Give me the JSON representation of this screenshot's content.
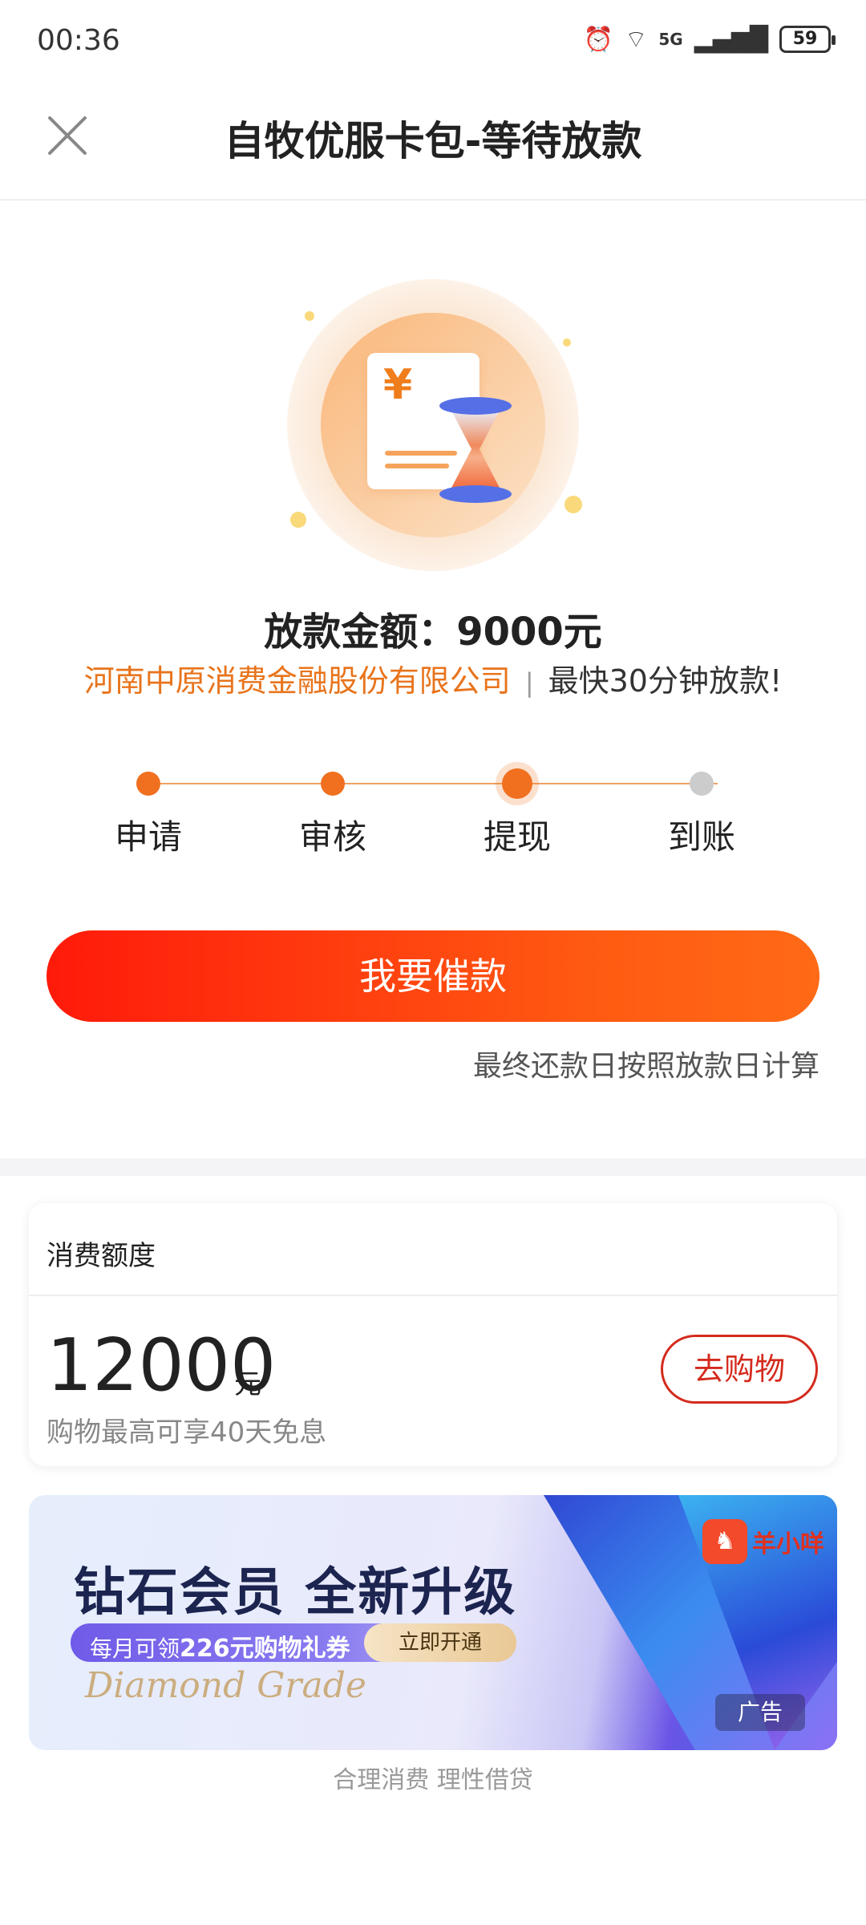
{
  "status_bar": {
    "time": "00:36",
    "battery": "59",
    "network": "5G"
  },
  "header": {
    "title": "自牧优服卡包-等待放款"
  },
  "loan": {
    "amount_text": "放款金额：9000元",
    "lender": "河南中原消费金融股份有限公司",
    "separator": "|",
    "speed": "最快30分钟放款!"
  },
  "steps": [
    {
      "label": "申请",
      "state": "done"
    },
    {
      "label": "审核",
      "state": "done"
    },
    {
      "label": "提现",
      "state": "current"
    },
    {
      "label": "到账",
      "state": "pending"
    }
  ],
  "cta": {
    "label": "我要催款"
  },
  "note": "最终还款日按照放款日计算",
  "credit": {
    "title": "消费额度",
    "amount": "12000",
    "unit": "元",
    "subtitle": "购物最高可享40天免息",
    "button": "去购物"
  },
  "banner": {
    "headline": "钻石会员  全新升级",
    "pill_prefix": "每月可领",
    "pill_highlight": "226元购物礼券",
    "open_label": "立即开通",
    "script_text": "Diamond Grade",
    "brand": "羊小咩",
    "ad_label": "广告"
  },
  "footer": "合理消费 理性借贷",
  "colors": {
    "accent": "#f07020",
    "cta_start": "#ff1a0a",
    "cta_end": "#ff6a16",
    "lender": "#e8741c",
    "shop_border": "#d42b1e"
  }
}
